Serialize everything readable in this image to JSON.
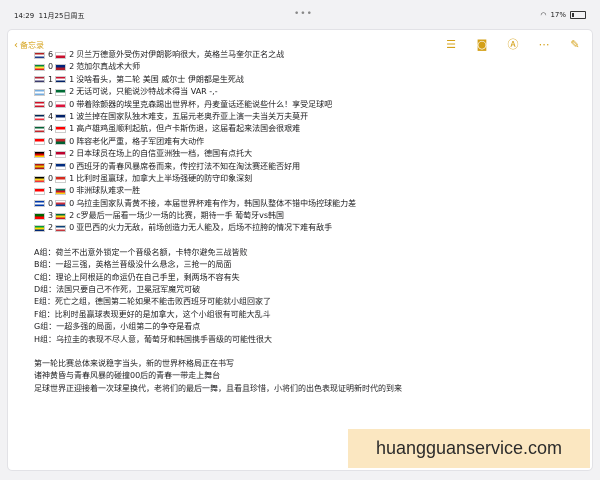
{
  "status": {
    "time": "14:29",
    "date": "11月25日周五",
    "battery": "17%"
  },
  "toolbar": {
    "back_label": "备忘录"
  },
  "matches": [
    {
      "flags": [
        "#b22222|#ffffff|#1e3c8c",
        "#ffffff|#c8102e"
      ],
      "score_a": "6",
      "score_b": "2",
      "text": "贝兰万德意外受伤对伊朗影响很大，英格兰马奎尔正名之战"
    },
    {
      "flags": [
        "#00853f|#fdef42|#e31b23",
        "#00247d|#ae1c28"
      ],
      "score_a": "0",
      "score_b": "2",
      "text": "范加尔真战术大师"
    },
    {
      "flags": [
        "#b22234|#ffffff|#3c3b6e",
        "#c8102e|#ffffff|#012169"
      ],
      "score_a": "1",
      "score_b": "1",
      "text": "没啥看头，第二轮 美国 威尔士 伊朗都是生死战"
    },
    {
      "flags": [
        "#74acdf|#ffffff|#74acdf",
        "#006c35|#ffffff"
      ],
      "score_a": "1",
      "score_b": "2",
      "text": "无话可说，只能说沙特战术得当 VAR -,-"
    },
    {
      "flags": [
        "#ce1126|#ffffff|#ce1126",
        "#ffffff|#dc143c"
      ],
      "score_a": "0",
      "score_b": "0",
      "text": "带着除颤器的埃里克森踢出世界杯，丹麦童话还能说些什么！享受足球吧"
    },
    {
      "flags": [
        "#002654|#ffffff|#ed2939",
        "#012169|#ffffff"
      ],
      "score_a": "4",
      "score_b": "1",
      "text": "波兰掉在国家队独木难支，五届元老奥乔亚上演一夫当关万夫莫开"
    },
    {
      "flags": [
        "#006233|#ffffff|#c1272d",
        "#ff0000|#ffffff"
      ],
      "score_a": "4",
      "score_b": "1",
      "text": "高卢雄鸡虽顺利起航，但卢卡斯伤退，这届看起来法国会很艰难"
    },
    {
      "flags": [
        "#ff0000|#ffffff",
        "#c1272d|#006233"
      ],
      "score_a": "0",
      "score_b": "0",
      "text": "阵容老化严重，格子军团难有大动作"
    },
    {
      "flags": [
        "#000000|#dd0000|#ffce00",
        "#bc002d|#ffffff"
      ],
      "score_a": "1",
      "score_b": "2",
      "text": "日本球员在场上的自信亚洲独一档，德国有点托大"
    },
    {
      "flags": [
        "#aa151b|#f1bf00|#aa151b",
        "#002b7f|#ffffff"
      ],
      "score_a": "7",
      "score_b": "0",
      "text": "西班牙的青春风暴席卷而来，传控打法不知在淘汰赛还能否好用"
    },
    {
      "flags": [
        "#000000|#fdda24|#ef3340",
        "#d52b1e|#ffffff"
      ],
      "score_a": "0",
      "score_b": "1",
      "text": "比利时虽赢球，加拿大上半场强硬的防守印象深刻"
    },
    {
      "flags": [
        "#ff0000|#ffffff",
        "#007a5e|#ce1126|#fcd116"
      ],
      "score_a": "1",
      "score_b": "0",
      "text": "非洲球队难求一胜"
    },
    {
      "flags": [
        "#0038a8|#ffffff|#0038a8",
        "#ffffff|#cd2e3a|#0047a0"
      ],
      "score_a": "0",
      "score_b": "0",
      "text": "乌拉圭国家队青黄不接，本届世界杯难有作为，韩国队整体不错中场控球能力差"
    },
    {
      "flags": [
        "#006600|#ff0000",
        "#006b3f|#fcd116|#ce1126"
      ],
      "score_a": "3",
      "score_b": "2",
      "text": "c罗最后一届看一场少一场的比赛，期待一手 葡萄牙vs韩国"
    },
    {
      "flags": [
        "#009c3b|#ffdf00|#002776",
        "#0c4076|#ffffff|#c6363c"
      ],
      "score_a": "2",
      "score_b": "0",
      "text": "亚巴西的火力无敌，前场创造力无人能及，后场不拉胯的情况下难有敌手"
    }
  ],
  "groups": [
    "A组：荷兰不出意外锁定一个晋级名额，卡特尔避免三战皆败",
    "B组：一超三强，英格兰晋级没什么悬念，三抢一的局面",
    "C组：理论上阿根廷的命运仍在自己手里，剩两场不容有失",
    "D组：法国只要自己不作死，卫冕冠军魔咒可破",
    "E组：死亡之组，德国第二轮如果不能击败西班牙可能就小组回家了",
    "F组：比利时虽赢球表现更好的是加拿大，这个小组很有可能大乱斗",
    "G组：一超多强的局面，小组第二的争夺是看点",
    "H组：乌拉圭的表现不尽人意，葡萄牙和韩国携手晋级的可能性很大"
  ],
  "summary": [
    "第一轮比赛总体来说稳字当头，新的世界杯格局正在书写",
    "诸神黄昏与青春风暴的碰撞00后的青春一带走上舞台",
    "足球世界正迎接着一次球星换代，老将们的最后一舞，且看且珍惜，小将们的出色表现证明新时代的到来"
  ],
  "watermark": {
    "text": "huangguanservice.com"
  },
  "accent": "#d4a017"
}
